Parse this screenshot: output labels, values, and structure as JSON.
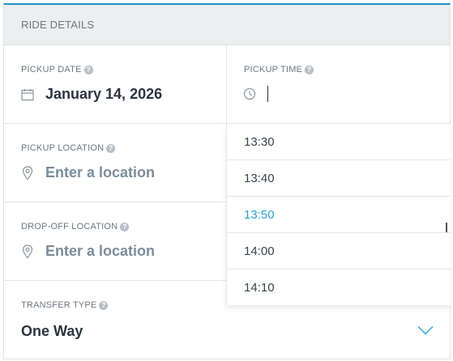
{
  "header": {
    "title": "RIDE DETAILS"
  },
  "pickup_date": {
    "label": "PICKUP DATE",
    "help": "?",
    "value": "January 14, 2026",
    "icon": "calendar-icon"
  },
  "pickup_time": {
    "label": "PICKUP TIME",
    "help": "?",
    "value": "",
    "icon": "clock-icon",
    "options": [
      "13:30",
      "13:40",
      "13:50",
      "14:00",
      "14:10"
    ],
    "selected": "13:50"
  },
  "pickup_location": {
    "label": "PICKUP LOCATION",
    "help": "?",
    "placeholder": "Enter a location",
    "icon": "location-pin-icon"
  },
  "dropoff_location": {
    "label": "DROP-OFF LOCATION",
    "help": "?",
    "placeholder": "Enter a location",
    "icon": "location-pin-icon"
  },
  "transfer_type": {
    "label": "TRANSFER TYPE",
    "help": "?",
    "value": "One Way",
    "icon": "chevron-down-icon"
  },
  "colors": {
    "accent": "#2a9fd6",
    "header_bg": "#eceeef",
    "placeholder": "#7b8d9b"
  }
}
